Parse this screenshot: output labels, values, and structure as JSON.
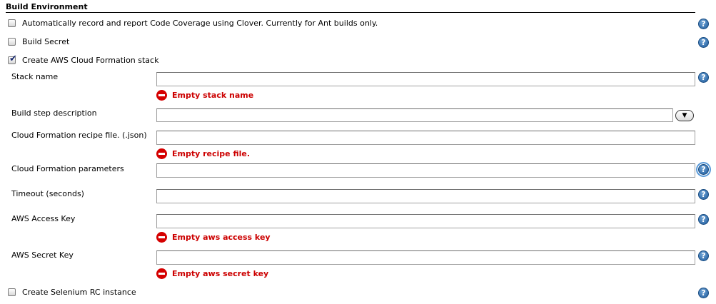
{
  "section": {
    "title": "Build Environment"
  },
  "options": {
    "clover": {
      "label": "Automatically record and report Code Coverage using Clover. Currently for Ant builds only.",
      "checked": false
    },
    "build_secret": {
      "label": "Build Secret",
      "checked": false
    },
    "aws_cloud_formation": {
      "label": "Create AWS Cloud Formation stack",
      "checked": true
    },
    "selenium": {
      "label": "Create Selenium RC instance",
      "checked": false
    }
  },
  "fields": {
    "stack_name": {
      "label": "Stack name",
      "value": "",
      "error": "Empty stack name"
    },
    "build_step_description": {
      "label": "Build step description",
      "value": ""
    },
    "recipe_file": {
      "label": "Cloud Formation recipe file. (.json)",
      "value": "",
      "error": "Empty recipe file."
    },
    "parameters": {
      "label": "Cloud Formation parameters",
      "value": ""
    },
    "timeout": {
      "label": "Timeout (seconds)",
      "value": ""
    },
    "access_key": {
      "label": "AWS Access Key",
      "value": "",
      "error": "Empty aws access key"
    },
    "secret_key": {
      "label": "AWS Secret Key",
      "value": "",
      "error": "Empty aws secret key"
    }
  },
  "icons": {
    "help": "help-icon",
    "error": "error-icon",
    "dropdown": "chevron-down-icon"
  },
  "colors": {
    "error_text": "#cc0000",
    "help_icon": "#1f5b9c",
    "focus_outline": "#5b9bd9"
  }
}
